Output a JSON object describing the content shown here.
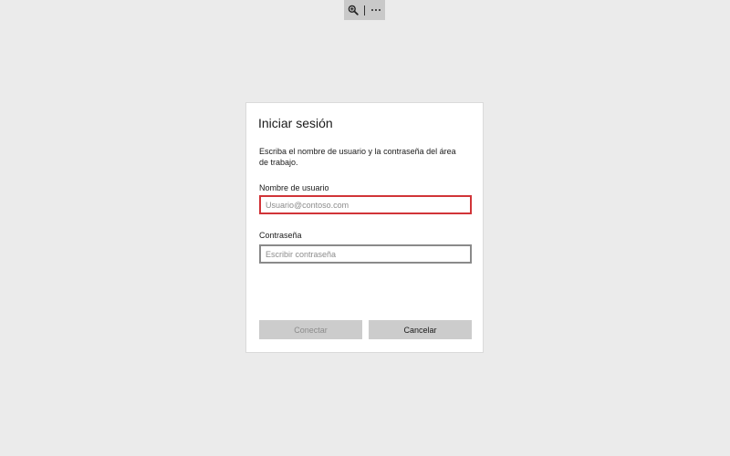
{
  "toolbar": {
    "zoom_icon": "zoom-in-icon",
    "more_icon": "more-options-icon",
    "more_glyph": "···"
  },
  "dialog": {
    "title": "Iniciar sesión",
    "description": "Escriba el nombre de usuario y la contraseña del área de trabajo.",
    "username": {
      "label": "Nombre de usuario",
      "value": "",
      "placeholder": "Usuario@contoso.com",
      "state": "error"
    },
    "password": {
      "label": "Contraseña",
      "value": "",
      "placeholder": "Escribir contraseña"
    },
    "connect_label": "Conectar",
    "connect_enabled": false,
    "cancel_label": "Cancelar"
  },
  "colors": {
    "background": "#ebebeb",
    "toolbar": "#c9c9c9",
    "error_border": "#d13438",
    "button": "#cccccc"
  }
}
